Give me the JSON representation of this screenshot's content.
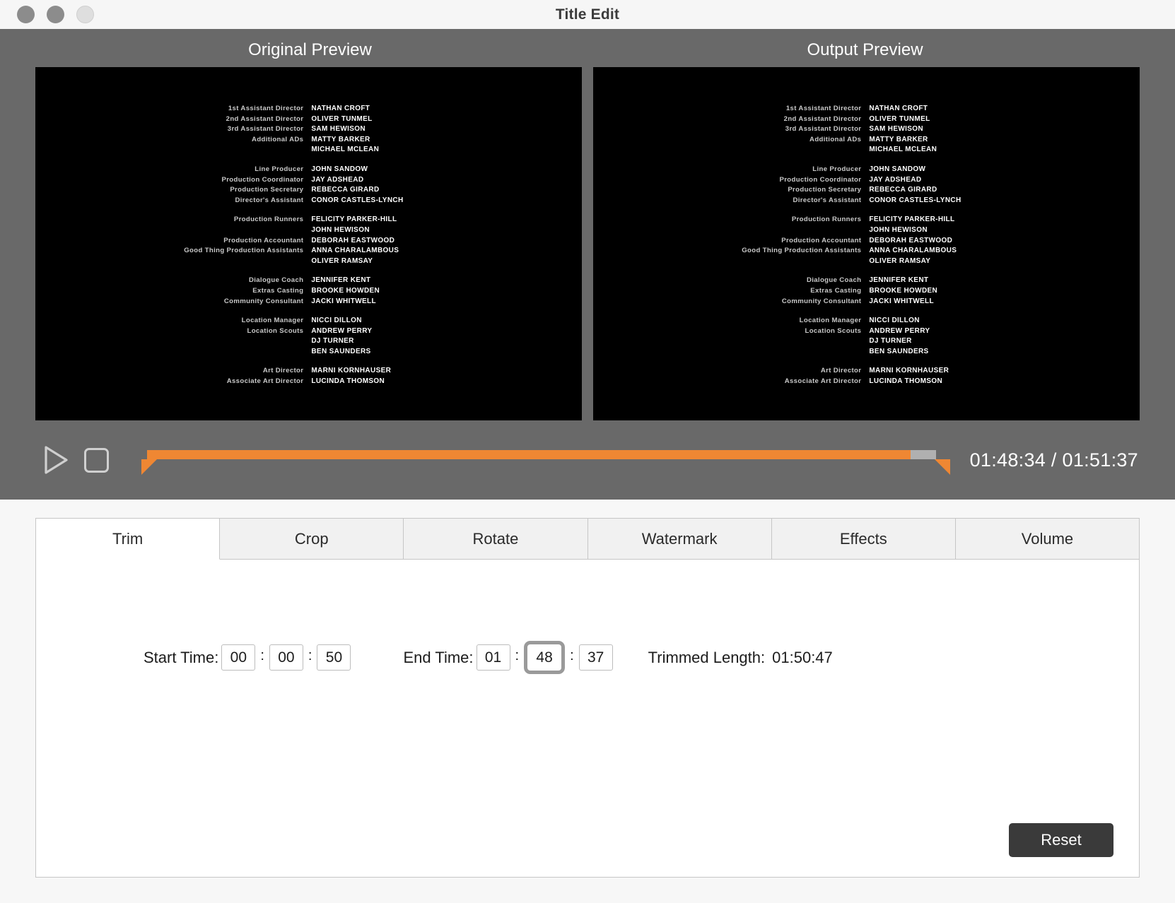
{
  "window": {
    "title": "Title Edit",
    "traffic_lights": [
      "close-button",
      "minimize-button",
      "zoom-button"
    ]
  },
  "preview": {
    "original_label": "Original Preview",
    "output_label": "Output  Preview",
    "credits": [
      {
        "rows": [
          {
            "role": "1st Assistant Director",
            "name": "NATHAN CROFT"
          },
          {
            "role": "2nd Assistant Director",
            "name": "OLIVER TUNMEL"
          },
          {
            "role": "3rd Assistant Director",
            "name": "SAM HEWISON"
          },
          {
            "role": "Additional ADs",
            "name": "MATTY BARKER"
          },
          {
            "role": "",
            "name": "MICHAEL MCLEAN"
          }
        ]
      },
      {
        "rows": [
          {
            "role": "Line Producer",
            "name": "JOHN SANDOW"
          },
          {
            "role": "Production Coordinator",
            "name": "JAY ADSHEAD"
          },
          {
            "role": "Production Secretary",
            "name": "REBECCA GIRARD"
          },
          {
            "role": "Director's Assistant",
            "name": "CONOR CASTLES-LYNCH"
          }
        ]
      },
      {
        "rows": [
          {
            "role": "Production Runners",
            "name": "FELICITY PARKER-HILL"
          },
          {
            "role": "",
            "name": "JOHN HEWISON"
          },
          {
            "role": "Production Accountant",
            "name": "DEBORAH EASTWOOD"
          },
          {
            "role": "Good Thing Production Assistants",
            "name": "ANNA CHARALAMBOUS"
          },
          {
            "role": "",
            "name": "OLIVER RAMSAY"
          }
        ]
      },
      {
        "rows": [
          {
            "role": "Dialogue Coach",
            "name": "JENNIFER KENT"
          },
          {
            "role": "Extras Casting",
            "name": "BROOKE HOWDEN"
          },
          {
            "role": "Community Consultant",
            "name": "JACKI WHITWELL"
          }
        ]
      },
      {
        "rows": [
          {
            "role": "Location Manager",
            "name": "NICCI DILLON"
          },
          {
            "role": "Location Scouts",
            "name": "ANDREW PERRY"
          },
          {
            "role": "",
            "name": "DJ TURNER"
          },
          {
            "role": "",
            "name": "BEN SAUNDERS"
          }
        ]
      },
      {
        "rows": [
          {
            "role": "Art Director",
            "name": "MARNI KORNHAUSER"
          },
          {
            "role": "Associate Art Director",
            "name": "LUCINDA THOMSON"
          }
        ]
      }
    ]
  },
  "transport": {
    "play_icon": "play-icon",
    "stop_icon": "stop-icon",
    "time_display": "01:48:34 / 01:51:37",
    "progress_percent": 96.8
  },
  "tabs": [
    {
      "label": "Trim",
      "active": true
    },
    {
      "label": "Crop",
      "active": false
    },
    {
      "label": "Rotate",
      "active": false
    },
    {
      "label": "Watermark",
      "active": false
    },
    {
      "label": "Effects",
      "active": false
    },
    {
      "label": "Volume",
      "active": false
    }
  ],
  "trim": {
    "start_label": "Start Time:",
    "start_hours": "00",
    "start_minutes": "00",
    "start_seconds": "50",
    "end_label": "End Time:",
    "end_hours": "01",
    "end_minutes": "48",
    "end_seconds": "37",
    "separator": ":",
    "length_label": "Trimmed Length:",
    "length_value": "01:50:47",
    "reset_label": "Reset"
  },
  "colors": {
    "accent": "#ef8733",
    "panel": "#696969",
    "reset_button": "#3a3a3a"
  }
}
